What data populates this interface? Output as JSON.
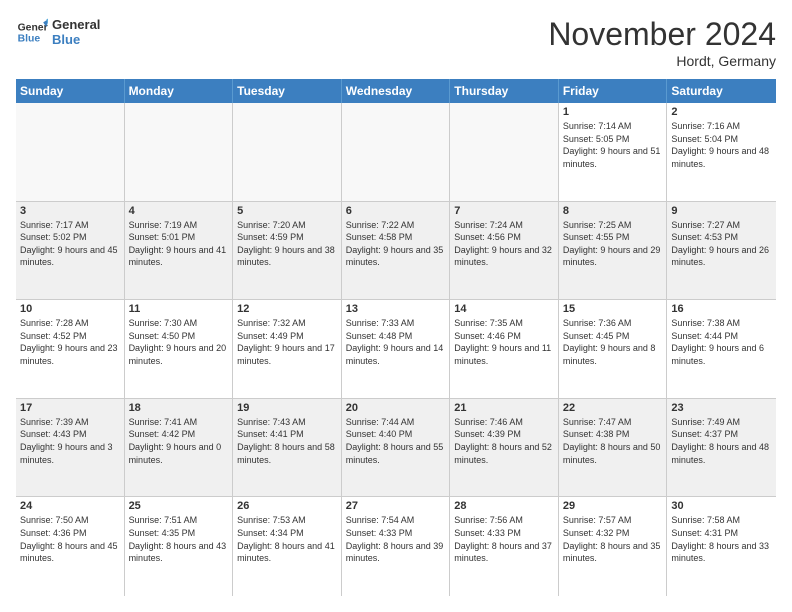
{
  "logo": {
    "line1": "General",
    "line2": "Blue"
  },
  "header": {
    "month": "November 2024",
    "location": "Hordt, Germany"
  },
  "days": [
    "Sunday",
    "Monday",
    "Tuesday",
    "Wednesday",
    "Thursday",
    "Friday",
    "Saturday"
  ],
  "weeks": [
    [
      {
        "day": "",
        "info": ""
      },
      {
        "day": "",
        "info": ""
      },
      {
        "day": "",
        "info": ""
      },
      {
        "day": "",
        "info": ""
      },
      {
        "day": "",
        "info": ""
      },
      {
        "day": "1",
        "info": "Sunrise: 7:14 AM\nSunset: 5:05 PM\nDaylight: 9 hours and 51 minutes."
      },
      {
        "day": "2",
        "info": "Sunrise: 7:16 AM\nSunset: 5:04 PM\nDaylight: 9 hours and 48 minutes."
      }
    ],
    [
      {
        "day": "3",
        "info": "Sunrise: 7:17 AM\nSunset: 5:02 PM\nDaylight: 9 hours and 45 minutes."
      },
      {
        "day": "4",
        "info": "Sunrise: 7:19 AM\nSunset: 5:01 PM\nDaylight: 9 hours and 41 minutes."
      },
      {
        "day": "5",
        "info": "Sunrise: 7:20 AM\nSunset: 4:59 PM\nDaylight: 9 hours and 38 minutes."
      },
      {
        "day": "6",
        "info": "Sunrise: 7:22 AM\nSunset: 4:58 PM\nDaylight: 9 hours and 35 minutes."
      },
      {
        "day": "7",
        "info": "Sunrise: 7:24 AM\nSunset: 4:56 PM\nDaylight: 9 hours and 32 minutes."
      },
      {
        "day": "8",
        "info": "Sunrise: 7:25 AM\nSunset: 4:55 PM\nDaylight: 9 hours and 29 minutes."
      },
      {
        "day": "9",
        "info": "Sunrise: 7:27 AM\nSunset: 4:53 PM\nDaylight: 9 hours and 26 minutes."
      }
    ],
    [
      {
        "day": "10",
        "info": "Sunrise: 7:28 AM\nSunset: 4:52 PM\nDaylight: 9 hours and 23 minutes."
      },
      {
        "day": "11",
        "info": "Sunrise: 7:30 AM\nSunset: 4:50 PM\nDaylight: 9 hours and 20 minutes."
      },
      {
        "day": "12",
        "info": "Sunrise: 7:32 AM\nSunset: 4:49 PM\nDaylight: 9 hours and 17 minutes."
      },
      {
        "day": "13",
        "info": "Sunrise: 7:33 AM\nSunset: 4:48 PM\nDaylight: 9 hours and 14 minutes."
      },
      {
        "day": "14",
        "info": "Sunrise: 7:35 AM\nSunset: 4:46 PM\nDaylight: 9 hours and 11 minutes."
      },
      {
        "day": "15",
        "info": "Sunrise: 7:36 AM\nSunset: 4:45 PM\nDaylight: 9 hours and 8 minutes."
      },
      {
        "day": "16",
        "info": "Sunrise: 7:38 AM\nSunset: 4:44 PM\nDaylight: 9 hours and 6 minutes."
      }
    ],
    [
      {
        "day": "17",
        "info": "Sunrise: 7:39 AM\nSunset: 4:43 PM\nDaylight: 9 hours and 3 minutes."
      },
      {
        "day": "18",
        "info": "Sunrise: 7:41 AM\nSunset: 4:42 PM\nDaylight: 9 hours and 0 minutes."
      },
      {
        "day": "19",
        "info": "Sunrise: 7:43 AM\nSunset: 4:41 PM\nDaylight: 8 hours and 58 minutes."
      },
      {
        "day": "20",
        "info": "Sunrise: 7:44 AM\nSunset: 4:40 PM\nDaylight: 8 hours and 55 minutes."
      },
      {
        "day": "21",
        "info": "Sunrise: 7:46 AM\nSunset: 4:39 PM\nDaylight: 8 hours and 52 minutes."
      },
      {
        "day": "22",
        "info": "Sunrise: 7:47 AM\nSunset: 4:38 PM\nDaylight: 8 hours and 50 minutes."
      },
      {
        "day": "23",
        "info": "Sunrise: 7:49 AM\nSunset: 4:37 PM\nDaylight: 8 hours and 48 minutes."
      }
    ],
    [
      {
        "day": "24",
        "info": "Sunrise: 7:50 AM\nSunset: 4:36 PM\nDaylight: 8 hours and 45 minutes."
      },
      {
        "day": "25",
        "info": "Sunrise: 7:51 AM\nSunset: 4:35 PM\nDaylight: 8 hours and 43 minutes."
      },
      {
        "day": "26",
        "info": "Sunrise: 7:53 AM\nSunset: 4:34 PM\nDaylight: 8 hours and 41 minutes."
      },
      {
        "day": "27",
        "info": "Sunrise: 7:54 AM\nSunset: 4:33 PM\nDaylight: 8 hours and 39 minutes."
      },
      {
        "day": "28",
        "info": "Sunrise: 7:56 AM\nSunset: 4:33 PM\nDaylight: 8 hours and 37 minutes."
      },
      {
        "day": "29",
        "info": "Sunrise: 7:57 AM\nSunset: 4:32 PM\nDaylight: 8 hours and 35 minutes."
      },
      {
        "day": "30",
        "info": "Sunrise: 7:58 AM\nSunset: 4:31 PM\nDaylight: 8 hours and 33 minutes."
      }
    ]
  ]
}
